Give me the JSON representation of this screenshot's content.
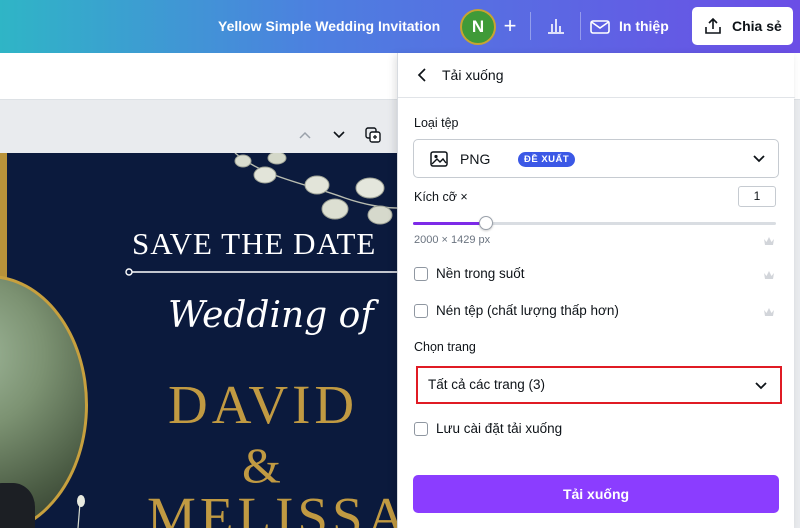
{
  "header": {
    "doc_title": "Yellow Simple Wedding Invitation",
    "avatar_initial": "N",
    "plus_label": "+",
    "print_label": "In thiệp",
    "share_label": "Chia sẻ",
    "colors": {
      "gradient_start": "#2fb5c6",
      "gradient_end": "#6b4ee6"
    }
  },
  "design": {
    "save_the_date": "SAVE THE DATE",
    "wedding_of": "Wedding of",
    "name1": "DAVID",
    "ampersand": "&",
    "name2": "MELISSA",
    "colors": {
      "background": "#0b1a3d",
      "gold": "#c19a42"
    }
  },
  "download_panel": {
    "title": "Tải xuống",
    "file_type_label": "Loại tệp",
    "file_type_value": "PNG",
    "file_type_badge": "ĐỀ XUẤT",
    "size_label": "Kích cỡ ×",
    "size_value": "1",
    "size_fraction": 0.2,
    "dimensions": "2000 × 1429 px",
    "transparent_bg": "Nền trong suốt",
    "compress_file": "Nén tệp (chất lượng thấp hơn)",
    "select_pages_label": "Chọn trang",
    "select_pages_value": "Tất cả các trang (3)",
    "save_settings": "Lưu cài đặt tải xuống",
    "download_button": "Tải xuống",
    "colors": {
      "accent": "#8b3dff",
      "badge": "#3b58e6",
      "highlight_border": "#e01b24"
    }
  }
}
